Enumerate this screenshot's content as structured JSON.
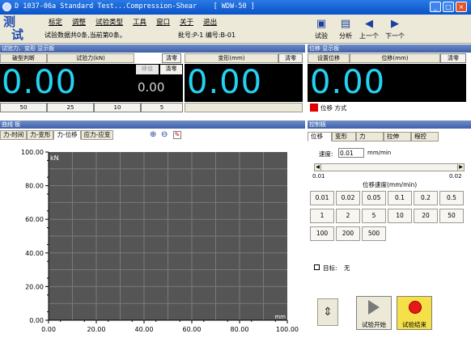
{
  "window": {
    "title": "D 1037-06a Standard Test...Compression-Shear    [ WDW-50 ]",
    "minimize": "_",
    "maximize": "□",
    "close": "×"
  },
  "logo": {
    "char1": "测",
    "char2": "试"
  },
  "menu": [
    "标定",
    "调整",
    "试验类型",
    "工具",
    "窗口",
    "关于",
    "退出"
  ],
  "info": {
    "text": "试验数据共0条,当前第0条。",
    "batch": "批号:P-1 编号:B-01"
  },
  "toolbar": {
    "test": "试验",
    "analyze": "分析",
    "prev": "上一个",
    "next": "下一个"
  },
  "force_panel": {
    "header": "试验力、变形 显示板",
    "break_label": "破型判断",
    "force_label": "试验力(kN)",
    "clear": "清零",
    "deform_label": "变形(mm)",
    "clear2": "清零",
    "force_value": "0.00",
    "deform_value": "0.00",
    "peak_label": "峰值",
    "peak_clear": "清零",
    "peak_value": "0.00",
    "ranges": [
      "50",
      "25",
      "10",
      "5"
    ]
  },
  "position_panel": {
    "header": "位移 显示板",
    "set_label": "设置位移",
    "pos_label": "位移(mm)",
    "clear": "清零",
    "value": "0.00",
    "mode_label": "位移 方式"
  },
  "curve_panel": {
    "header": "曲线 板",
    "tabs": [
      "力-时间",
      "力-变形",
      "力-位移",
      "应力-应变"
    ]
  },
  "control_panel": {
    "header": "控制板",
    "tabs": [
      "位移",
      "变形",
      "力",
      "拉伸",
      "程控"
    ],
    "speed_label": "速度:",
    "speed_value": "0.01",
    "speed_unit": "mm/min",
    "slider_min": "0.01",
    "slider_max": "0.02",
    "speed_title": "位移速度(mm/min)",
    "speed_buttons": [
      "0.01",
      "0.02",
      "0.05",
      "0.1",
      "0.2",
      "0.5",
      "1",
      "2",
      "5",
      "10",
      "20",
      "50",
      "100",
      "200",
      "500"
    ],
    "target_label": "目标:",
    "target_value": "无",
    "start_label": "试验开始",
    "end_label": "试验结束"
  },
  "chart_data": {
    "type": "line",
    "ylabel": "kN",
    "xlabel": "mm",
    "xlim": [
      0,
      100
    ],
    "ylim": [
      0,
      100
    ],
    "xticks": [
      "0.00",
      "20.00",
      "40.00",
      "60.00",
      "80.00",
      "100.00"
    ],
    "yticks": [
      "0.00",
      "20.00",
      "40.00",
      "60.00",
      "80.00",
      "100.00"
    ],
    "series": [],
    "grid": true
  },
  "colors": {
    "display_digits": "#24d2f3",
    "chart_bg": "#555555",
    "grid": "#7a7a7a",
    "title_bar": "#0a52c8",
    "panel_header": "#4f6fb8"
  }
}
